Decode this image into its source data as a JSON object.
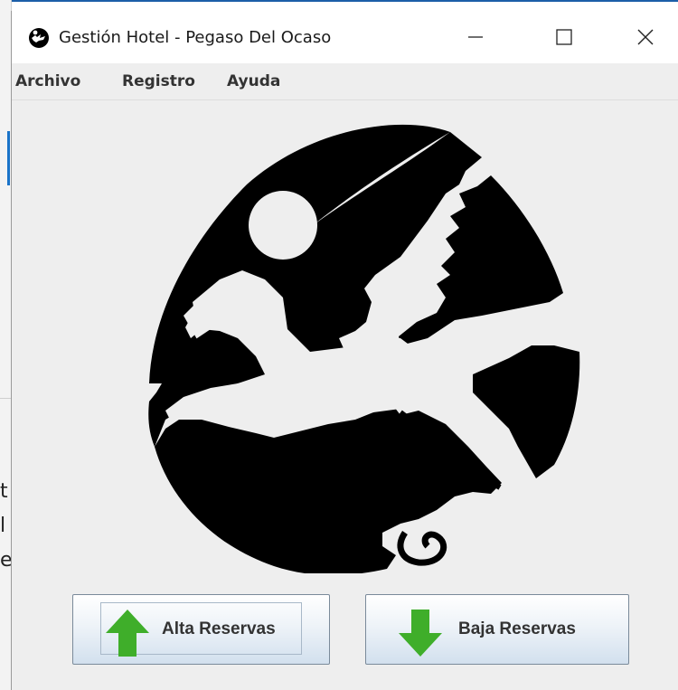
{
  "window": {
    "title": "Gestión Hotel - Pegaso Del Ocaso",
    "app_icon": "pegasus-icon",
    "controls": {
      "minimize": "minimize-icon",
      "maximize": "maximize-icon",
      "close": "close-icon"
    }
  },
  "menubar": {
    "items": [
      {
        "label": "Archivo"
      },
      {
        "label": "Registro"
      },
      {
        "label": "Ayuda"
      }
    ]
  },
  "content": {
    "logo": "pegasus-logo",
    "buttons": {
      "alta": {
        "label": "Alta Reservas",
        "icon": "arrow-up-icon"
      },
      "baja": {
        "label": "Baja Reservas",
        "icon": "arrow-down-icon"
      }
    }
  },
  "background": {
    "letters": [
      "t",
      "l",
      "e"
    ]
  },
  "colors": {
    "button_arrow_green": "#3fae2a",
    "logo_black": "#000000",
    "window_bg": "#eeeeee"
  }
}
